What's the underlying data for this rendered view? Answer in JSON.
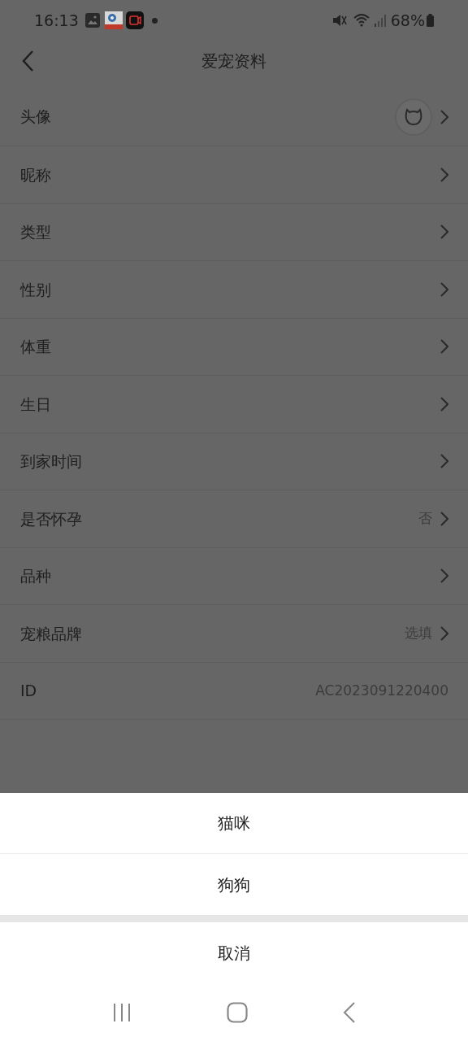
{
  "status_bar": {
    "time": "16:13",
    "battery": "68%"
  },
  "header": {
    "title": "爱宠资料"
  },
  "rows": [
    {
      "label": "头像",
      "kind": "avatar",
      "chevron": true
    },
    {
      "label": "昵称",
      "kind": "text",
      "chevron": true
    },
    {
      "label": "类型",
      "kind": "text",
      "chevron": true
    },
    {
      "label": "性别",
      "kind": "text",
      "chevron": true
    },
    {
      "label": "体重",
      "kind": "text",
      "chevron": true
    },
    {
      "label": "生日",
      "kind": "text",
      "chevron": true
    },
    {
      "label": "到家时间",
      "kind": "text",
      "chevron": true
    },
    {
      "label": "是否怀孕",
      "kind": "text",
      "value": "否",
      "chevron": true
    },
    {
      "label": "品种",
      "kind": "text",
      "chevron": true
    },
    {
      "label": "宠粮品牌",
      "kind": "text",
      "value": "选填",
      "chevron": true
    },
    {
      "label": "ID",
      "kind": "text",
      "value": "AC2023091220400",
      "chevron": false
    }
  ],
  "sheet": {
    "options": [
      "猫咪",
      "狗狗"
    ],
    "cancel": "取消"
  }
}
